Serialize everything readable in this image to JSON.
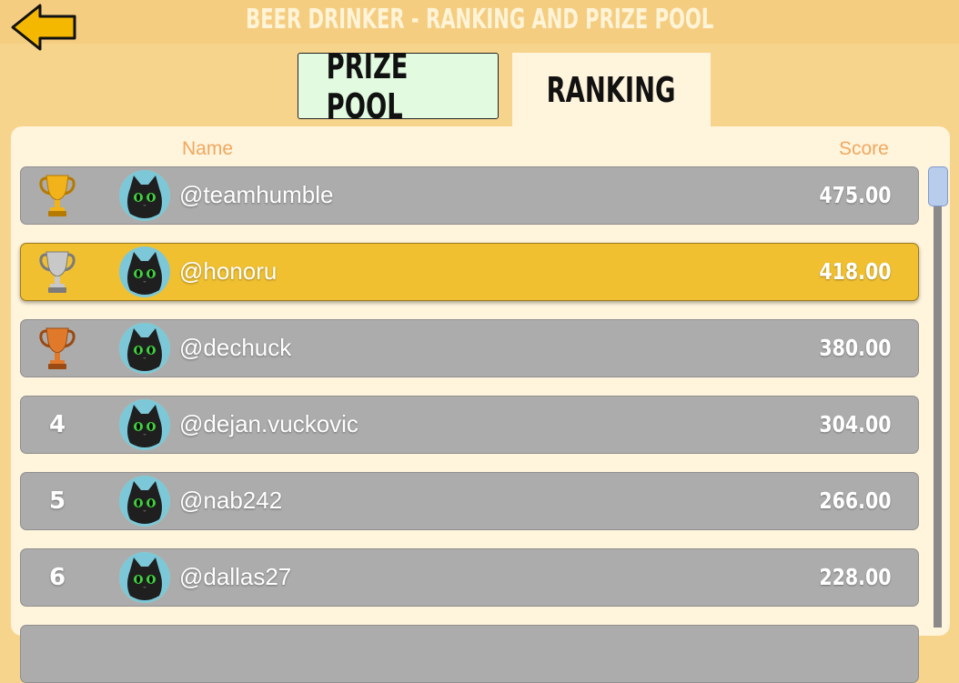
{
  "header": {
    "title": "BEER DRINKER - RANKING AND PRIZE POOL",
    "back_icon": "back-arrow-icon"
  },
  "tabs": [
    {
      "label": "PRIZE POOL",
      "active": false
    },
    {
      "label": "RANKING",
      "active": true
    }
  ],
  "columns": {
    "name": "Name",
    "score": "Score"
  },
  "rows": [
    {
      "rank": "1",
      "rank_icon": "gold-trophy-icon",
      "username": "@teamhumble",
      "score": "475.00",
      "highlighted": false
    },
    {
      "rank": "2",
      "rank_icon": "silver-trophy-icon",
      "username": "@honoru",
      "score": "418.00",
      "highlighted": true
    },
    {
      "rank": "3",
      "rank_icon": "bronze-trophy-icon",
      "username": "@dechuck",
      "score": "380.00",
      "highlighted": false
    },
    {
      "rank": "4",
      "rank_icon": "",
      "username": "@dejan.vuckovic",
      "score": "304.00",
      "highlighted": false
    },
    {
      "rank": "5",
      "rank_icon": "",
      "username": "@nab242",
      "score": "266.00",
      "highlighted": false
    },
    {
      "rank": "6",
      "rank_icon": "",
      "username": "@dallas27",
      "score": "228.00",
      "highlighted": false
    }
  ],
  "colors": {
    "background": "#f7d48c",
    "row": "#acacac",
    "highlight_row": "#f0c030",
    "column_header": "#f0a860",
    "gold": "#f2b21a",
    "silver": "#c8c8c8",
    "bronze": "#e07a2a"
  }
}
